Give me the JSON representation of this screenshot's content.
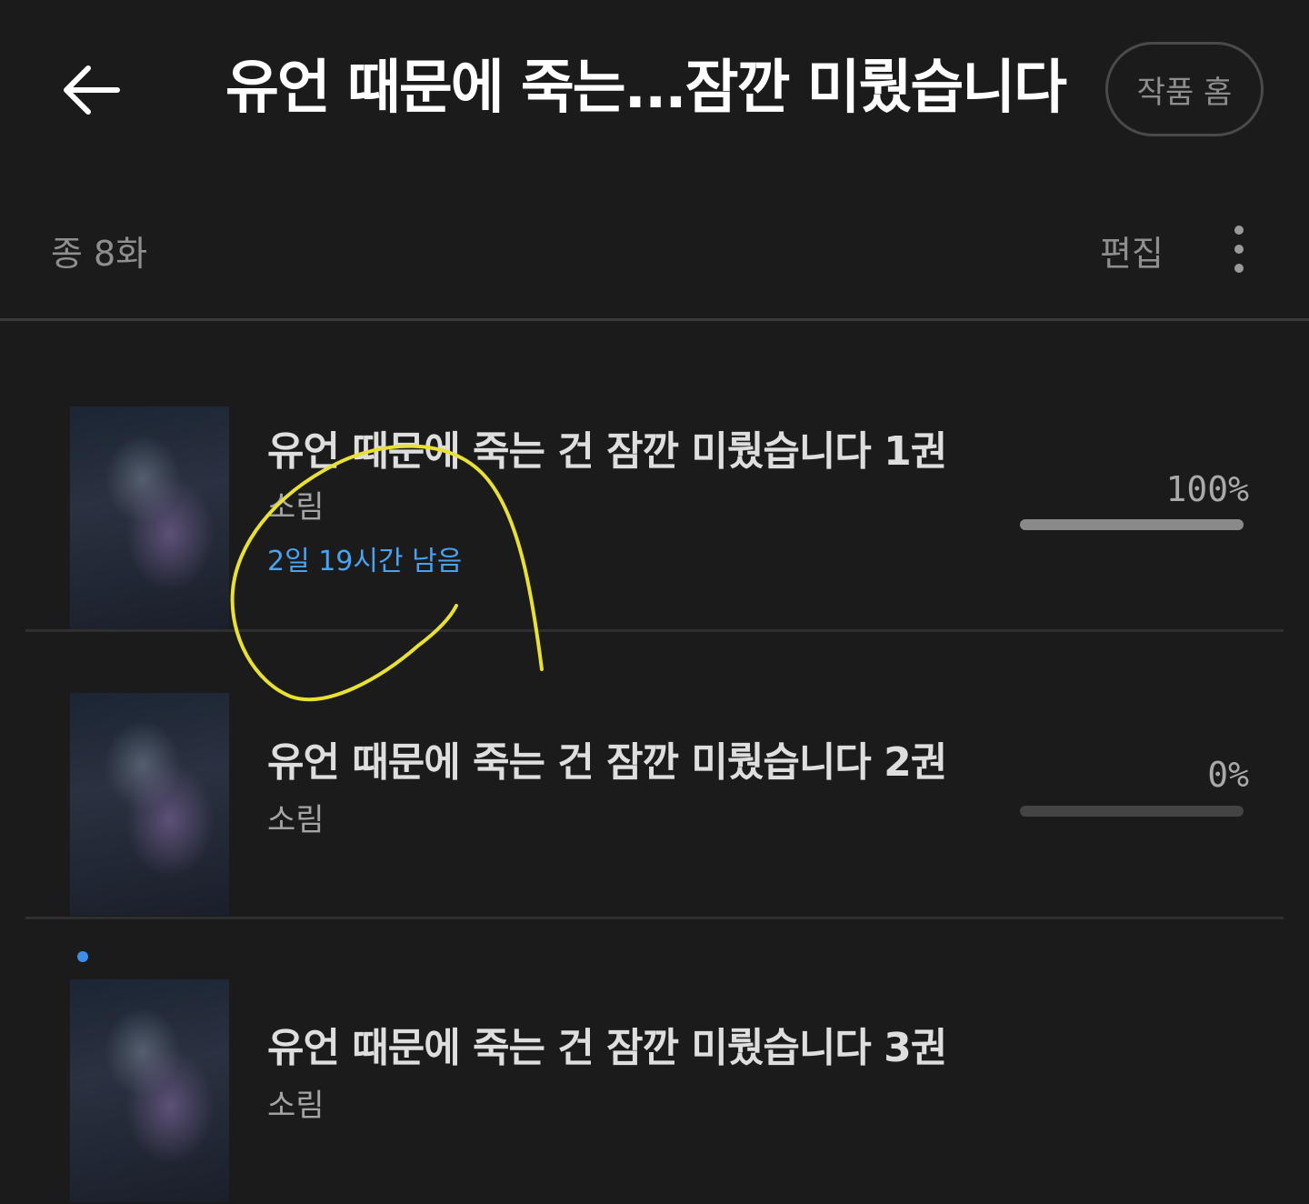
{
  "header": {
    "title": "유언 때문에 죽는...잠깐 미뤘습니다",
    "home_button": "작품 홈"
  },
  "subbar": {
    "total_count": "종 8화",
    "edit": "편집"
  },
  "episodes": [
    {
      "title": "유언 때문에 죽는 건 잠깐 미뤘습니다 1권",
      "author": "소림",
      "remaining": "2일 19시간 남음",
      "percent": "100%",
      "progress": 1.0
    },
    {
      "title": "유언 때문에 죽는 건 잠깐 미뤘습니다 2권",
      "author": "소림",
      "percent": "0%",
      "progress": 0.0
    },
    {
      "title": "유언 때문에 죽는 건 잠깐 미뤘습니다 3권",
      "author": "소림"
    }
  ],
  "colors": {
    "background": "#1b1b1b",
    "accent_blue": "#4aa3f0",
    "annotation_yellow": "#e8e035"
  },
  "icons": {
    "back": "arrow-left-icon",
    "more": "vertical-dots-icon"
  }
}
